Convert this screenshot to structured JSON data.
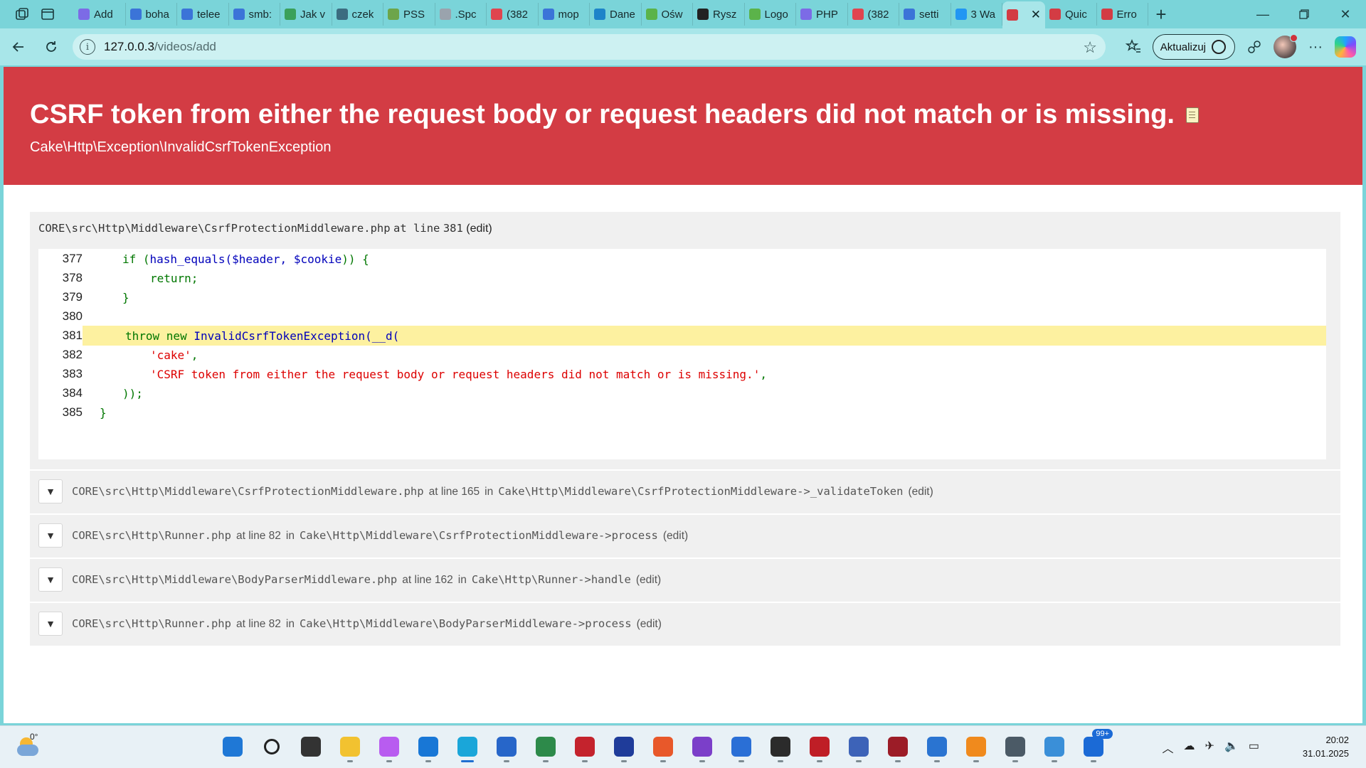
{
  "browser": {
    "tabs": [
      {
        "title": "Add",
        "color": "#7c6be6"
      },
      {
        "title": "boha",
        "color": "#3b74d8"
      },
      {
        "title": "telee",
        "color": "#3b74d8"
      },
      {
        "title": "smb:",
        "color": "#3b74d8"
      },
      {
        "title": "Jak v",
        "color": "#3aa05a"
      },
      {
        "title": "czek",
        "color": "#3c6c80"
      },
      {
        "title": "PSS",
        "color": "#6da54a"
      },
      {
        "title": ".Spc",
        "color": "#9aa3ad"
      },
      {
        "title": "(382",
        "color": "#e0454f"
      },
      {
        "title": "mop",
        "color": "#3b74d8"
      },
      {
        "title": "Dane",
        "color": "#1d84c9"
      },
      {
        "title": "Ośw",
        "color": "#5bb34a"
      },
      {
        "title": "Rysz",
        "color": "#222222"
      },
      {
        "title": "Logo",
        "color": "#5bb34a"
      },
      {
        "title": "PHP",
        "color": "#7c6be6"
      },
      {
        "title": "(382",
        "color": "#e0454f"
      },
      {
        "title": "setti",
        "color": "#3b74d8"
      },
      {
        "title": "3 Wa",
        "color": "#2196f3"
      }
    ],
    "active_tab": {
      "title": "",
      "color": "#d33c44",
      "close": "✕"
    },
    "tabs_after": [
      {
        "title": "Quic",
        "color": "#d33c44"
      },
      {
        "title": "Erro",
        "color": "#d33c44"
      }
    ],
    "new_tab": "+",
    "url_host": "127.0.0.3",
    "url_path": "/videos/add",
    "update_label": "Aktualizuj"
  },
  "error": {
    "message": "CSRF token from either the request body or request headers did not match or is missing.",
    "exception_class": "Cake\\Http\\Exception\\InvalidCsrfTokenException"
  },
  "frame": {
    "file": "CORE\\src\\Http\\Middleware\\CsrfProtectionMiddleware.php",
    "at_line": "at line",
    "line": "381",
    "edit": "(edit)"
  },
  "code_lines": [
    {
      "num": "377",
      "highlight": false
    },
    {
      "num": "378",
      "highlight": false
    },
    {
      "num": "379",
      "highlight": false
    },
    {
      "num": "380",
      "highlight": false
    },
    {
      "num": "381",
      "highlight": true
    },
    {
      "num": "382",
      "highlight": false
    },
    {
      "num": "383",
      "highlight": false
    },
    {
      "num": "384",
      "highlight": false
    },
    {
      "num": "385",
      "highlight": false
    }
  ],
  "code": {
    "l377_if": "if (",
    "l377_fn": "hash_equals($header, $cookie",
    "l377_end": ")) {",
    "l378": "return;",
    "l379": "}",
    "l381_kw": "throw new ",
    "l381_fn": "InvalidCsrfTokenException(__d(",
    "l382_str": "'cake'",
    "l382_end": ",",
    "l383_str": "'CSRF token from either the request body or request headers did not match or is missing.'",
    "l383_end": ",",
    "l384": "));",
    "l385": "}"
  },
  "stack": [
    {
      "toggle": "▼",
      "file": "CORE\\src\\Http\\Middleware\\CsrfProtectionMiddleware.php",
      "at": "at line 165",
      "in": "in",
      "call": "Cake\\Http\\Middleware\\CsrfProtectionMiddleware->_validateToken",
      "edit": "(edit)"
    },
    {
      "toggle": "▼",
      "file": "CORE\\src\\Http\\Runner.php",
      "at": "at line 82",
      "in": "in",
      "call": "Cake\\Http\\Middleware\\CsrfProtectionMiddleware->process",
      "edit": "(edit)"
    },
    {
      "toggle": "▼",
      "file": "CORE\\src\\Http\\Middleware\\BodyParserMiddleware.php",
      "at": "at line 162",
      "in": "in",
      "call": "Cake\\Http\\Runner->handle",
      "edit": "(edit)"
    },
    {
      "toggle": "▼",
      "file": "CORE\\src\\Http\\Runner.php",
      "at": "at line 82",
      "in": "in",
      "call": "Cake\\Http\\Middleware\\BodyParserMiddleware->process",
      "edit": "(edit)"
    }
  ],
  "taskbar": {
    "temperature": "0°",
    "apps": [
      {
        "name": "start",
        "color": "#1f78d6"
      },
      {
        "name": "search",
        "color": "#222222"
      },
      {
        "name": "task-view",
        "color": "#333333"
      },
      {
        "name": "file-explorer",
        "color": "#f2c230"
      },
      {
        "name": "copilot",
        "color": "#b85cf0"
      },
      {
        "name": "outlook",
        "color": "#1877d6"
      },
      {
        "name": "edge",
        "color": "#1aa6d9"
      },
      {
        "name": "store",
        "color": "#2766c9"
      },
      {
        "name": "vs-code-like",
        "color": "#2d8a4a"
      },
      {
        "name": "media",
        "color": "#c4232d"
      },
      {
        "name": "save",
        "color": "#1f3c9a"
      },
      {
        "name": "git",
        "color": "#e8582a"
      },
      {
        "name": "github",
        "color": "#7b3fc9"
      },
      {
        "name": "firefox-dev",
        "color": "#2a6fd6"
      },
      {
        "name": "terminal",
        "color": "#2b2b2b"
      },
      {
        "name": "filezilla",
        "color": "#bf1e26"
      },
      {
        "name": "network",
        "color": "#3d63b8"
      },
      {
        "name": "d-app",
        "color": "#9c1c27"
      },
      {
        "name": "notepad",
        "color": "#2a74d1"
      },
      {
        "name": "player",
        "color": "#f08a1d"
      },
      {
        "name": "settings",
        "color": "#4b5a66"
      },
      {
        "name": "control-panel",
        "color": "#3a8fd8"
      },
      {
        "name": "teams-like",
        "color": "#1b6ad6"
      }
    ],
    "badge": "99+",
    "time": "20:02",
    "date": "31.01.2025"
  }
}
